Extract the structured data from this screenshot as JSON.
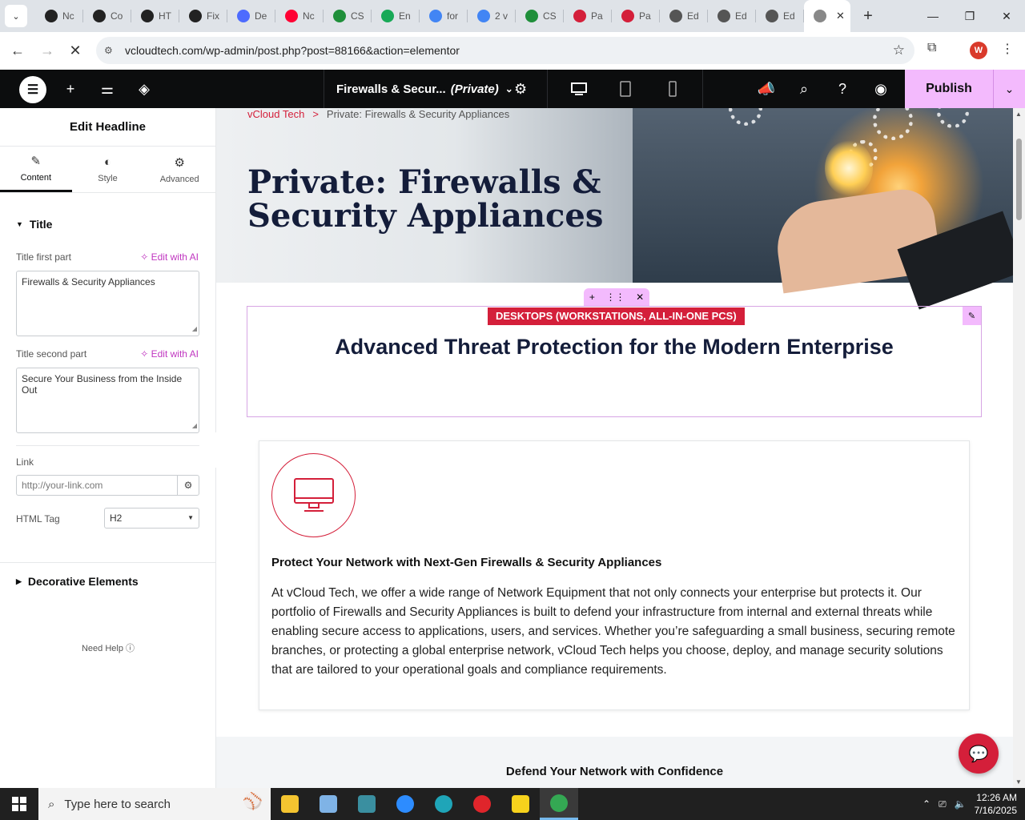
{
  "browser": {
    "tabs": [
      {
        "label": "Nc",
        "icon": "openai-icon",
        "color": "#222222"
      },
      {
        "label": "Co",
        "icon": "openai-icon",
        "color": "#222222"
      },
      {
        "label": "HT",
        "icon": "openai-icon",
        "color": "#222222"
      },
      {
        "label": "Fix",
        "icon": "openai-icon",
        "color": "#222222"
      },
      {
        "label": "De",
        "icon": "deepseek-icon",
        "color": "#4d6bfe"
      },
      {
        "label": "Nc",
        "icon": "youtube-icon",
        "color": "#ff0033"
      },
      {
        "label": "CS",
        "icon": "wps-icon",
        "color": "#1f8f3a"
      },
      {
        "label": "En",
        "icon": "grammarly-icon",
        "color": "#18a957"
      },
      {
        "label": "for",
        "icon": "google-icon",
        "color": "#4285f4"
      },
      {
        "label": "2 v",
        "icon": "google-icon",
        "color": "#4285f4"
      },
      {
        "label": "CS",
        "icon": "wps-icon",
        "color": "#1f8f3a"
      },
      {
        "label": "Pa",
        "icon": "diamond-icon",
        "color": "#d41f3a"
      },
      {
        "label": "Pa",
        "icon": "diamond-icon",
        "color": "#d41f3a"
      },
      {
        "label": "Ed",
        "icon": "wordpress-icon",
        "color": "#555555"
      },
      {
        "label": "Ed",
        "icon": "wordpress-icon",
        "color": "#555555"
      },
      {
        "label": "Ed",
        "icon": "wordpress-icon",
        "color": "#555555"
      }
    ],
    "active_tab_close": "✕",
    "url": "vcloudtech.com/wp-admin/post.php?post=88166&action=elementor",
    "profile_initial": "W"
  },
  "elementor": {
    "doc_title": "Firewalls & Secur...",
    "doc_status": "(Private)",
    "publish_label": "Publish"
  },
  "panel": {
    "title": "Edit Headline",
    "tabs": [
      {
        "label": "Content",
        "icon": "pencil-icon"
      },
      {
        "label": "Style",
        "icon": "half-circle-icon"
      },
      {
        "label": "Advanced",
        "icon": "gear-icon"
      }
    ],
    "section_title": "Title",
    "first_part_label": "Title first part",
    "edit_with_ai": "Edit with AI",
    "first_part_value": "Firewalls & Security Appliances",
    "second_part_label": "Title second part",
    "second_part_value": "Secure Your Business from the Inside Out",
    "link_label": "Link",
    "link_placeholder": "http://your-link.com",
    "html_tag_label": "HTML Tag",
    "html_tag_value": "H2",
    "decorative_label": "Decorative Elements",
    "need_help": "Need Help"
  },
  "page": {
    "breadcrumb_home": "vCloud Tech",
    "breadcrumb_sep": ">",
    "breadcrumb_current": "Private: Firewalls & Security Appliances",
    "h1": "Private: Firewalls & Security Appliances",
    "badge": "DESKTOPS (WORKSTATIONS, ALL-IN-ONE PCS)",
    "headline": "Advanced Threat Protection for the Modern Enterprise",
    "card_title": "Protect Your Network with Next-Gen Firewalls & Security Appliances",
    "card_body": "At vCloud Tech, we offer a wide range of Network Equipment that not only connects your enterprise but protects it. Our portfolio of Firewalls and Security Appliances is built to defend your infrastructure from internal and external threats while enabling secure access to applications, users, and services. Whether you’re safeguarding a small business, securing remote branches, or protecting a global enterprise network, vCloud Tech helps you choose, deploy, and manage security solutions that are tailored to your operational goals and compliance requirements.",
    "lower_title": "Defend Your Network with Confidence"
  },
  "taskbar": {
    "search_placeholder": "Type here to search",
    "time": "12:26 AM",
    "date": "7/16/2025",
    "apps": [
      {
        "name": "file-explorer",
        "color": "#f4c430"
      },
      {
        "name": "paint",
        "color": "#7fb3e6"
      },
      {
        "name": "app-green",
        "color": "#3a8fa0"
      },
      {
        "name": "zoom",
        "color": "#2d8cff"
      },
      {
        "name": "edge",
        "color": "#1fa5b8"
      },
      {
        "name": "opera",
        "color": "#e0252b"
      },
      {
        "name": "sticky-notes",
        "color": "#f7d21c"
      },
      {
        "name": "chrome",
        "color": "#34a853"
      }
    ]
  }
}
